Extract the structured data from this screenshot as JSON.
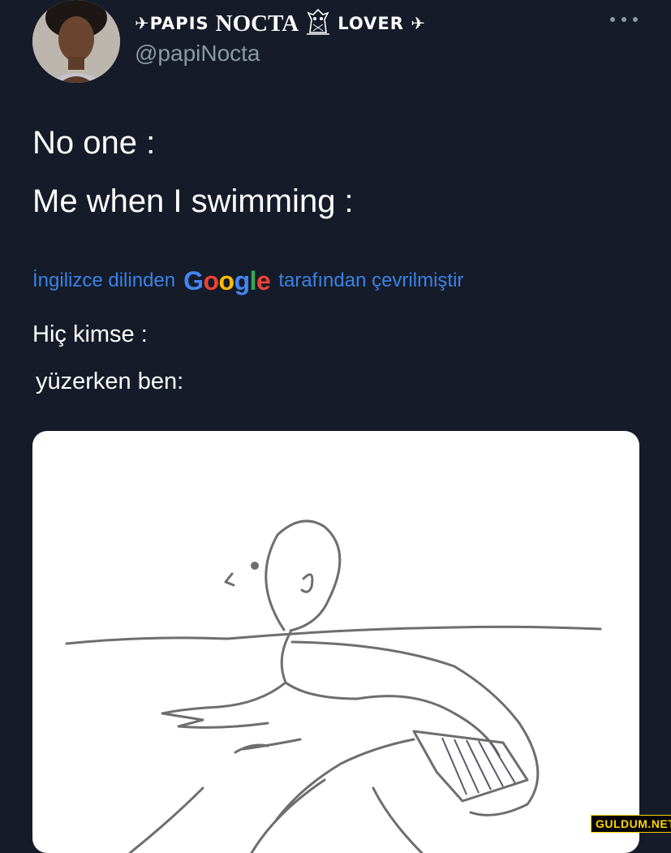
{
  "author": {
    "name_prefix": "✈PAPIS",
    "name_main": "NOCTA",
    "name_suffix": "LOVER ✈",
    "handle": "@papiNocta",
    "owl_icon": "owl-icon"
  },
  "tweet": {
    "line1": "No one :",
    "line2": "Me when I swimming :"
  },
  "translation": {
    "prefix": "İngilizce dilinden",
    "google_logo": {
      "letters": [
        "G",
        "o",
        "o",
        "g",
        "l",
        "e"
      ],
      "colors": [
        "#4285F4",
        "#EA4335",
        "#FBBC05",
        "#4285F4",
        "#34A853",
        "#EA4335"
      ]
    },
    "suffix": "tarafından çevrilmiştir",
    "line1": "Hiç kimse :",
    "line2": "yüzerken ben:"
  },
  "watermark": "GULDUM.NET",
  "colors": {
    "background": "#151b28",
    "secondary_text": "#8b98a5",
    "link": "#3b82e6"
  },
  "icons": {
    "more": "more-dots-icon"
  }
}
